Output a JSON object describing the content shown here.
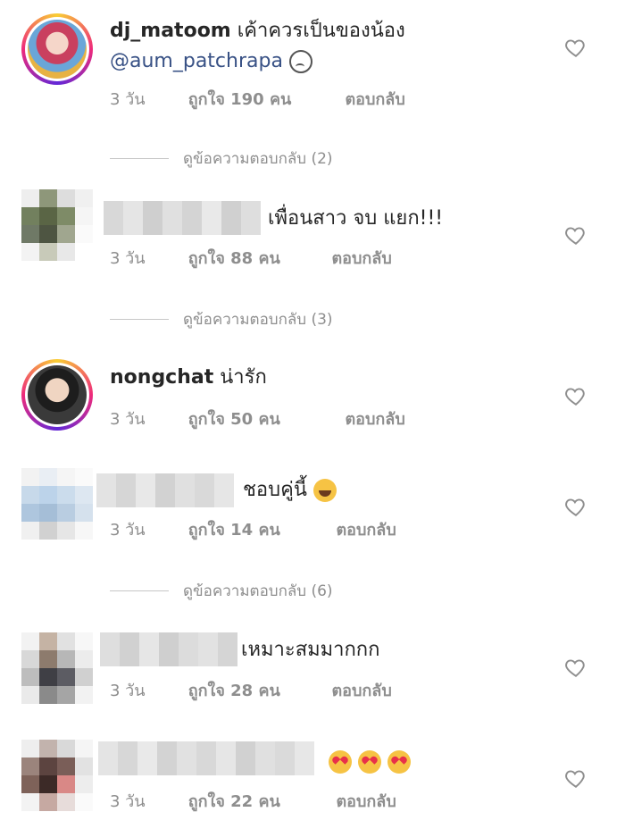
{
  "colors": {
    "text": "#262626",
    "muted": "#8e8e8e",
    "mention": "#385185"
  },
  "comments": [
    {
      "username": "dj_matoom",
      "text": "เค้าควรเป็นของน้อง",
      "mention": "@aum_patchrapa",
      "time": "3 วัน",
      "likes": "ถูกใจ 190 คน",
      "reply": "ตอบกลับ"
    },
    {
      "text": "เพื่อนสาว จบ แยก!!!",
      "time": "3 วัน",
      "likes": "ถูกใจ 88 คน",
      "reply": "ตอบกลับ"
    },
    {
      "username": "nongchat",
      "text": "น่ารัก",
      "time": "3 วัน",
      "likes": "ถูกใจ 50 คน",
      "reply": "ตอบกลับ"
    },
    {
      "text": "ชอบคู่นี้",
      "time": "3 วัน",
      "likes": "ถูกใจ 14 คน",
      "reply": "ตอบกลับ"
    },
    {
      "text": "เหมาะสมมากกก",
      "time": "3 วัน",
      "likes": "ถูกใจ 28 คน",
      "reply": "ตอบกลับ"
    },
    {
      "text": "",
      "time": "3 วัน",
      "likes": "ถูกใจ 22 คน",
      "reply": "ตอบกลับ"
    }
  ],
  "view_replies": [
    "ดูข้อความตอบกลับ (2)",
    "ดูข้อความตอบกลับ (3)",
    "ดูข้อความตอบกลับ (6)"
  ],
  "icons": {
    "heart": "heart-icon",
    "sad": "frowning-face-icon",
    "laugh": "laughing-face-icon",
    "love": "heart-eyes-face-icon"
  }
}
